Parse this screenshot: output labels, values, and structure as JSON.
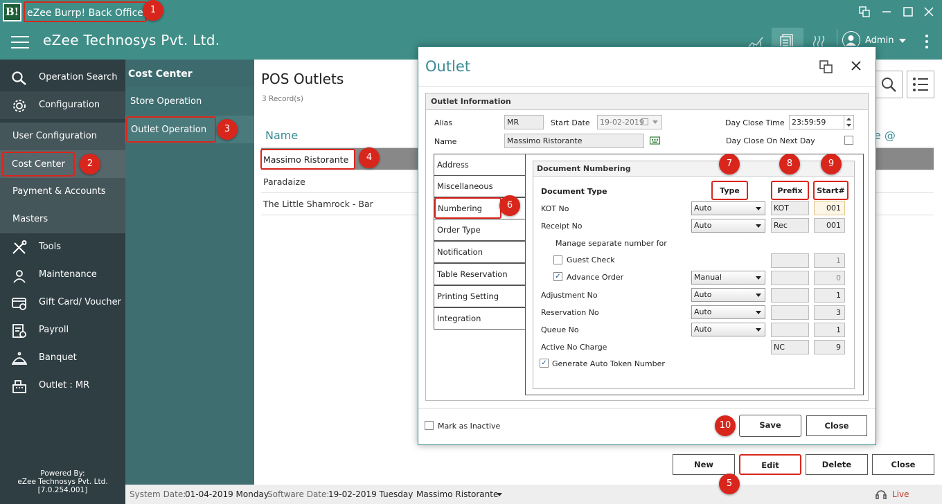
{
  "window": {
    "title": "eZee Burrp! Back Office",
    "icon_text": "B!"
  },
  "header": {
    "company": "eZee Technosys Pvt. Ltd.",
    "user": "Admin"
  },
  "sidebar": {
    "items": [
      {
        "label": "Operation Search",
        "icon": "search-icon"
      },
      {
        "label": "Configuration",
        "icon": "gear-icon"
      },
      {
        "label": "User Configuration"
      },
      {
        "label": "Cost Center"
      },
      {
        "label": "Payment & Accounts"
      },
      {
        "label": "Masters"
      },
      {
        "label": "Tools",
        "icon": "tools-icon"
      },
      {
        "label": "Maintenance",
        "icon": "maintenance-icon"
      },
      {
        "label": "Gift Card/ Voucher",
        "icon": "gift-card-icon"
      },
      {
        "label": "Payroll",
        "icon": "payroll-icon"
      },
      {
        "label": "Banquet",
        "icon": "banquet-icon"
      },
      {
        "label": "Outlet : MR",
        "icon": "outlet-icon"
      }
    ],
    "powered_by": "Powered By:",
    "powered_company": "eZee Technosys Pvt. Ltd.",
    "version": "[7.0.254.001]"
  },
  "cost_center": {
    "title": "Cost Center",
    "items": [
      "Store Operation",
      "Outlet Operation"
    ]
  },
  "main": {
    "title": "POS Outlets",
    "records": "3 Record(s)",
    "col_name": "Name",
    "col_right": "e @",
    "rows": [
      "Massimo Ristorante",
      "Paradaize",
      "The Little Shamrock - Bar"
    ],
    "buttons": {
      "new": "New",
      "edit": "Edit",
      "delete": "Delete",
      "close": "Close"
    }
  },
  "status": {
    "system_date_label": "System Date:",
    "system_date": "01-04-2019 Monday",
    "software_date_label": "Software Date:",
    "software_date": "19-02-2019 Tuesday",
    "outlet": "Massimo Ristorante",
    "live_support": "Live Support"
  },
  "dialog": {
    "title": "Outlet",
    "section": "Outlet Information",
    "alias_label": "Alias",
    "alias_value": "MR",
    "start_date_label": "Start Date",
    "start_date_value": "19-02-2019",
    "day_close_time_label": "Day Close Time",
    "day_close_time_value": "23:59:59",
    "name_label": "Name",
    "name_value": "Massimo Ristorante",
    "day_close_next_label": "Day Close On Next Day",
    "tabs": [
      "Address",
      "Miscellaneous",
      "Numbering",
      "Order Type",
      "Notification",
      "Table Reservation",
      "Printing Setting",
      "Integration"
    ],
    "doc_numbering": "Document Numbering",
    "col_doc_type": "Document Type",
    "col_type": "Type",
    "col_prefix": "Prefix",
    "col_start": "Start#",
    "kot_label": "KOT No",
    "kot_type": "Auto",
    "kot_prefix": "KOT",
    "kot_start": "001",
    "receipt_label": "Receipt No",
    "receipt_type": "Auto",
    "receipt_prefix": "Rec",
    "receipt_start": "001",
    "manage_label": "Manage separate number for",
    "guest_label": "Guest Check",
    "guest_start": "1",
    "advance_label": "Advance Order",
    "advance_type": "Manual",
    "advance_start": "0",
    "adjust_label": "Adjustment No",
    "adjust_type": "Auto",
    "adjust_start": "1",
    "reserv_label": "Reservation No",
    "reserv_type": "Auto",
    "reserv_start": "3",
    "queue_label": "Queue No",
    "queue_type": "Auto",
    "queue_start": "1",
    "nc_label": "Active No Charge",
    "nc_prefix": "NC",
    "nc_start": "9",
    "token_label": "Generate Auto Token Number",
    "inactive_label": "Mark as Inactive",
    "save": "Save",
    "close": "Close"
  },
  "annotations": [
    "1",
    "2",
    "3",
    "4",
    "5",
    "6",
    "7",
    "8",
    "9",
    "10"
  ],
  "colors": {
    "teal": "#3f8e88",
    "sidebar": "#2f3e43",
    "highlight": "#d9261c"
  }
}
